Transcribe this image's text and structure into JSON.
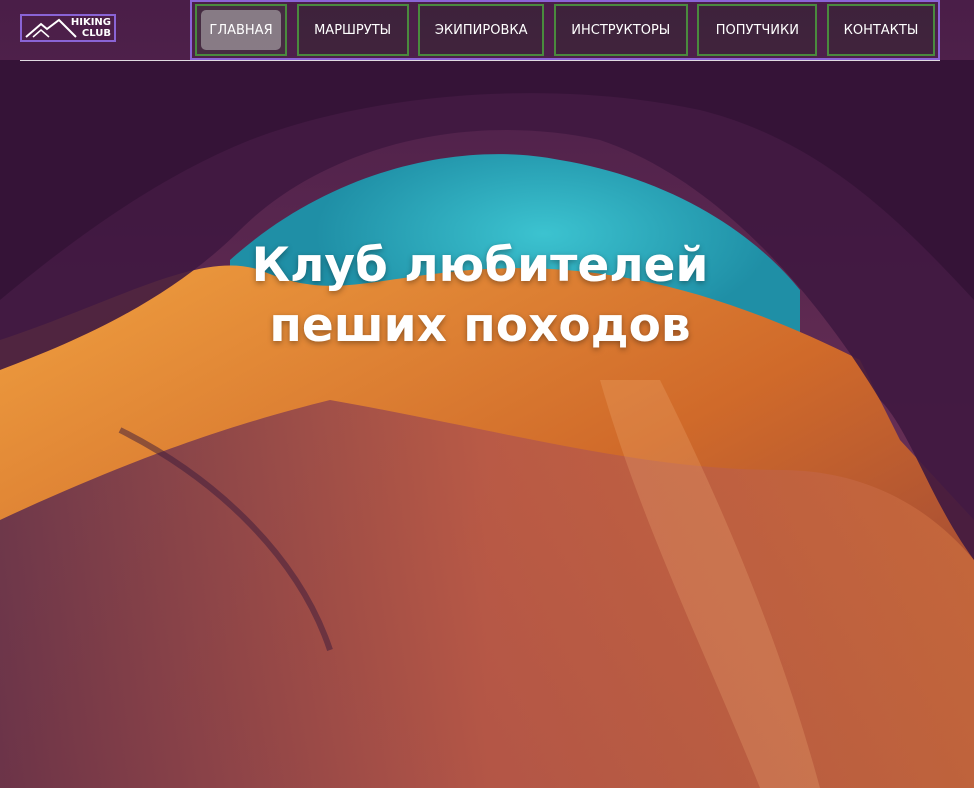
{
  "logo": {
    "line1": "HIKING",
    "line2": "CLUB"
  },
  "nav": {
    "items": [
      {
        "label": "ГЛАВНАЯ",
        "active": true
      },
      {
        "label": "МАРШРУТЫ",
        "active": false
      },
      {
        "label": "ЭКИПИРОВКА",
        "active": false
      },
      {
        "label": "ИНСТРУКТОРЫ",
        "active": false
      },
      {
        "label": "ПОПУТЧИКИ",
        "active": false
      },
      {
        "label": "КОНТАКТЫ",
        "active": false
      }
    ]
  },
  "hero": {
    "title_line1": "Клуб любителей",
    "title_line2": "пеших походов",
    "background": "canyon-arch-photo"
  },
  "colors": {
    "accent_border": "#8a64d6",
    "nav_border": "#4a8a3e",
    "sky": "#2fb3c4",
    "rock_orange": "#e07a2a",
    "rock_purple": "#5a2555"
  }
}
